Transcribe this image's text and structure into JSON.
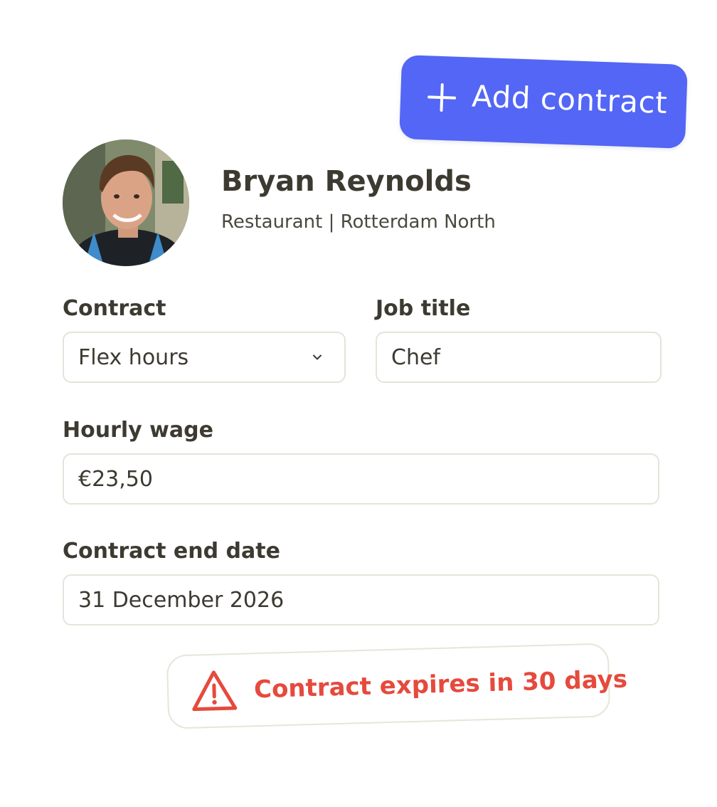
{
  "add_contract": {
    "label": "Add contract",
    "color": "#5366f5"
  },
  "profile": {
    "name": "Bryan Reynolds",
    "subtitle": "Restaurant | Rotterdam North"
  },
  "form": {
    "contract": {
      "label": "Contract",
      "value": "Flex hours"
    },
    "job_title": {
      "label": "Job title",
      "value": "Chef"
    },
    "hourly_wage": {
      "label": "Hourly wage",
      "value": "€23,50"
    },
    "end_date": {
      "label": "Contract end date",
      "value": "31 December 2026"
    }
  },
  "alert": {
    "text": "Contract expires in 30 days",
    "icon": "warning-triangle-icon",
    "color": "#e54a3d"
  },
  "icons": {
    "add": "plus-icon",
    "dropdown": "chevron-down-icon"
  }
}
